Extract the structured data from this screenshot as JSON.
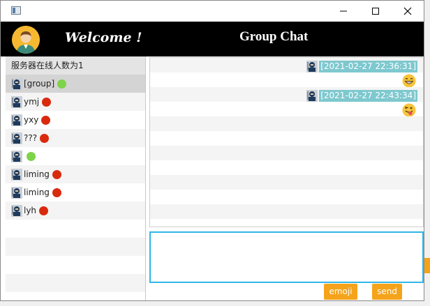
{
  "window": {
    "title": ""
  },
  "header": {
    "welcome": "Welcome !",
    "chat_title": "Group Chat"
  },
  "sidebar": {
    "server_count": "服务器在线人数为1",
    "users": [
      {
        "name": "[group]",
        "status": "online",
        "selected": true
      },
      {
        "name": "ymj",
        "status": "offline"
      },
      {
        "name": "yxy",
        "status": "offline"
      },
      {
        "name": "???",
        "status": "offline"
      },
      {
        "name": "",
        "status": "online"
      },
      {
        "name": "liming",
        "status": "offline"
      },
      {
        "name": "liming",
        "status": "offline"
      },
      {
        "name": "lyh",
        "status": "offline"
      }
    ]
  },
  "chat": {
    "messages": [
      {
        "timestamp": "[2021-02-27 22:36:31]",
        "emoji": "grinning-face"
      },
      {
        "timestamp": "[2021-02-27 22:43:34]",
        "emoji": "winking-tongue-face"
      }
    ]
  },
  "input": {
    "value": ""
  },
  "buttons": {
    "emoji": "emoji",
    "send": "send"
  },
  "colors": {
    "online": "#7ed348",
    "offline": "#d92a0e",
    "accent": "#f5a31a",
    "timestamp_bg": "#7ec8cf",
    "header_bg": "#000000"
  }
}
